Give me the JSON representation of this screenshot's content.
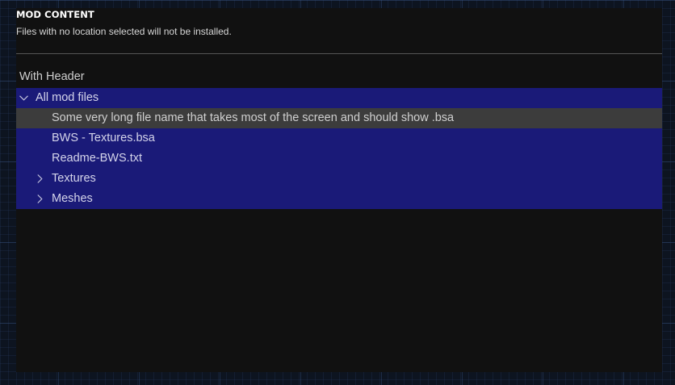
{
  "panel": {
    "title": "MOD CONTENT",
    "subtitle": "Files with no location selected will not be installed."
  },
  "tree": {
    "header_label": "With Header",
    "root": {
      "label": "All mod files",
      "expanded": true,
      "icon": "chevron-down-icon"
    },
    "items": [
      {
        "label": "Some very long file name that takes most of the screen and should show .bsa",
        "type": "file",
        "selected": true
      },
      {
        "label": "BWS - Textures.bsa",
        "type": "file",
        "selected": false
      },
      {
        "label": "Readme-BWS.txt",
        "type": "file",
        "selected": false
      },
      {
        "label": "Textures",
        "type": "folder",
        "expanded": false,
        "icon": "chevron-right-icon"
      },
      {
        "label": "Meshes",
        "type": "folder",
        "expanded": false,
        "icon": "chevron-right-icon"
      }
    ]
  },
  "colors": {
    "background": "#0d1420",
    "panel": "#111111",
    "tree_background": "#1a1a78",
    "selected_row": "#3c3c3c",
    "divider": "#555555"
  }
}
